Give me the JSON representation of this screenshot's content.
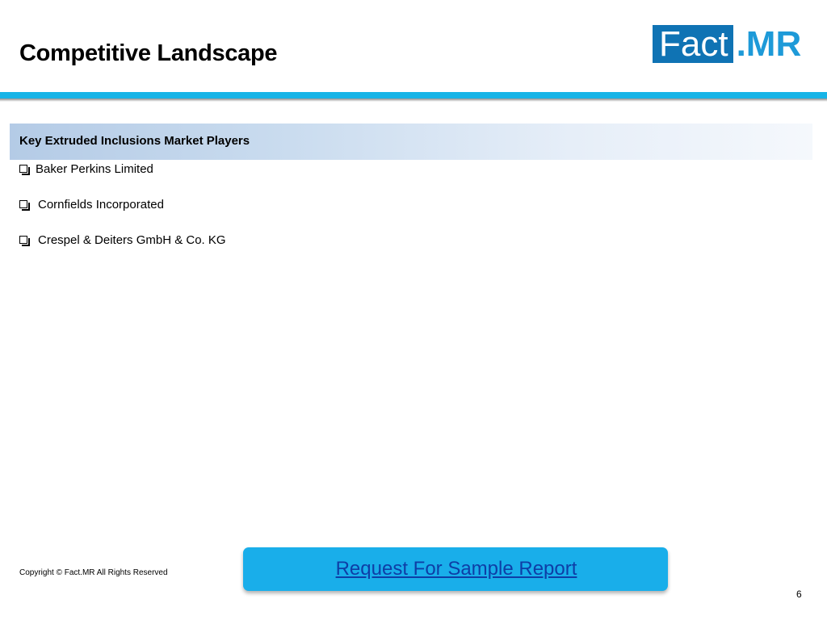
{
  "header": {
    "title": "Competitive Landscape",
    "logo": {
      "box_text": "Fact",
      "suffix_text": ".MR"
    }
  },
  "section": {
    "heading": "Key Extruded Inclusions Market Players",
    "players": [
      "Baker Perkins Limited",
      "Cornfields Incorporated",
      "Crespel & Deiters GmbH & Co. KG"
    ]
  },
  "footer": {
    "copyright": "Copyright © Fact.MR All Rights Reserved",
    "cta_label": "Request For Sample Report",
    "page_number": "6"
  },
  "colors": {
    "accent_rule": "#17b4e7",
    "logo_box": "#0f73b4",
    "logo_suffix": "#1e9ad8",
    "cta_background": "#19aeea",
    "cta_text": "#0e3ea6"
  }
}
